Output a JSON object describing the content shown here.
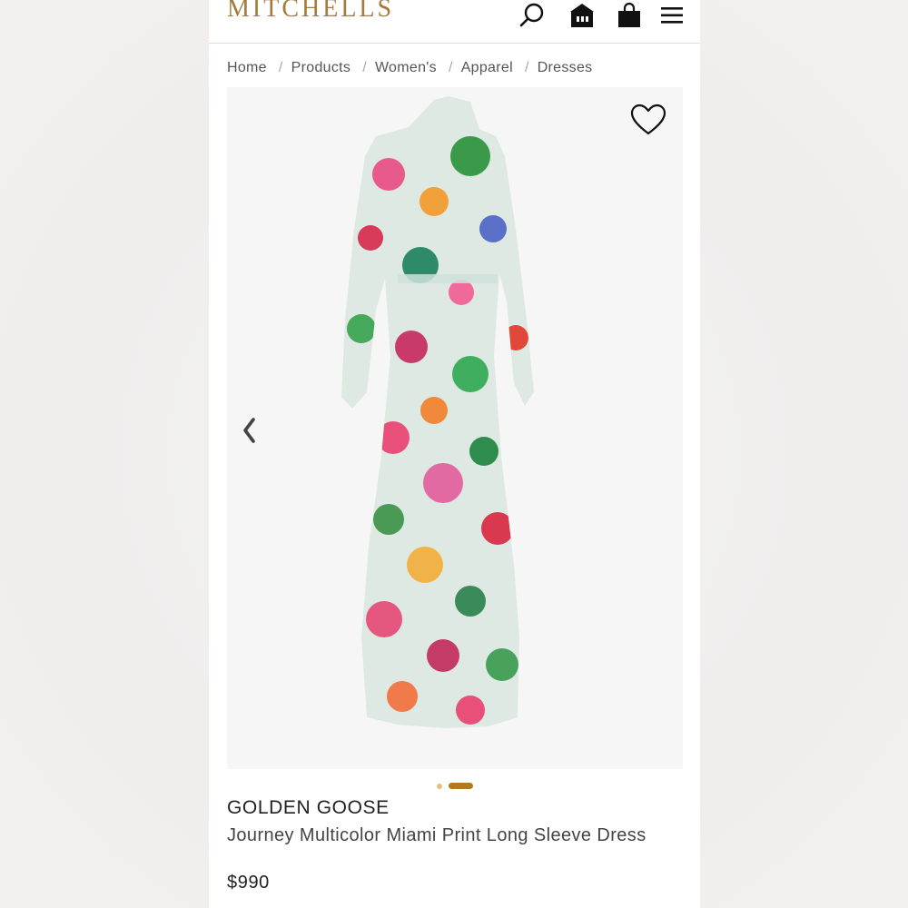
{
  "header": {
    "logo": "MITCHELLS",
    "icons": [
      "search-icon",
      "store-icon",
      "shopping-bag-icon",
      "menu-icon"
    ]
  },
  "breadcrumb": [
    "Home",
    "Products",
    "Women's",
    "Apparel",
    "Dresses"
  ],
  "gallery": {
    "image_count": 2,
    "active_index": 1
  },
  "product": {
    "brand": "GOLDEN GOOSE",
    "name": "Journey Multicolor Miami Print Long Sleeve Dress",
    "price": "$990"
  },
  "colors": {
    "logo_gold": "#a47b3d",
    "active_dot": "#b07a1f",
    "inactive_dot": "#e2c07a"
  }
}
